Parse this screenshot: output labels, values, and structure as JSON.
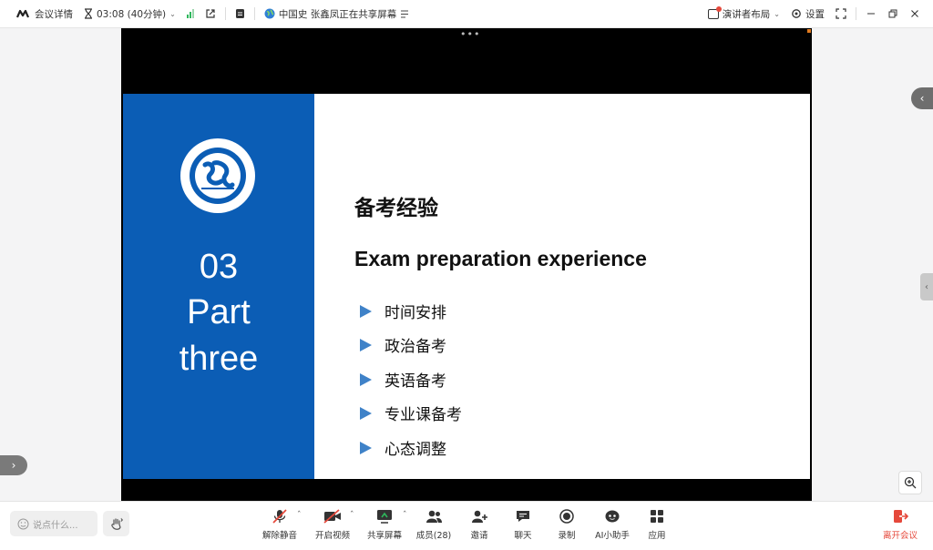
{
  "titlebar": {
    "meeting_info": "会议详情",
    "timer": "03:08 (40分钟)",
    "sharing_status": "中国史 张鑫凤正在共享屏幕",
    "layout": "演讲者布局",
    "settings": "设置"
  },
  "slide": {
    "part_number": "03",
    "part_word1": "Part",
    "part_word2": "three",
    "title_cn": "备考经验",
    "title_en": "Exam preparation experience",
    "bullets": [
      "时间安排",
      "政治备考",
      "英语备考",
      "专业课备考",
      "心态调整"
    ],
    "accent_color": "#0b5db5",
    "bullet_color": "#3f82c8"
  },
  "toolbar": {
    "chat_placeholder": "说点什么...",
    "unmute": "解除静音",
    "start_video": "开启视频",
    "share_screen": "共享屏幕",
    "members": "成员(28)",
    "invite": "邀请",
    "chat": "聊天",
    "record": "录制",
    "ai_assistant": "AI小助手",
    "apps": "应用",
    "leave": "离开会议",
    "leave_color": "#e5483b"
  }
}
